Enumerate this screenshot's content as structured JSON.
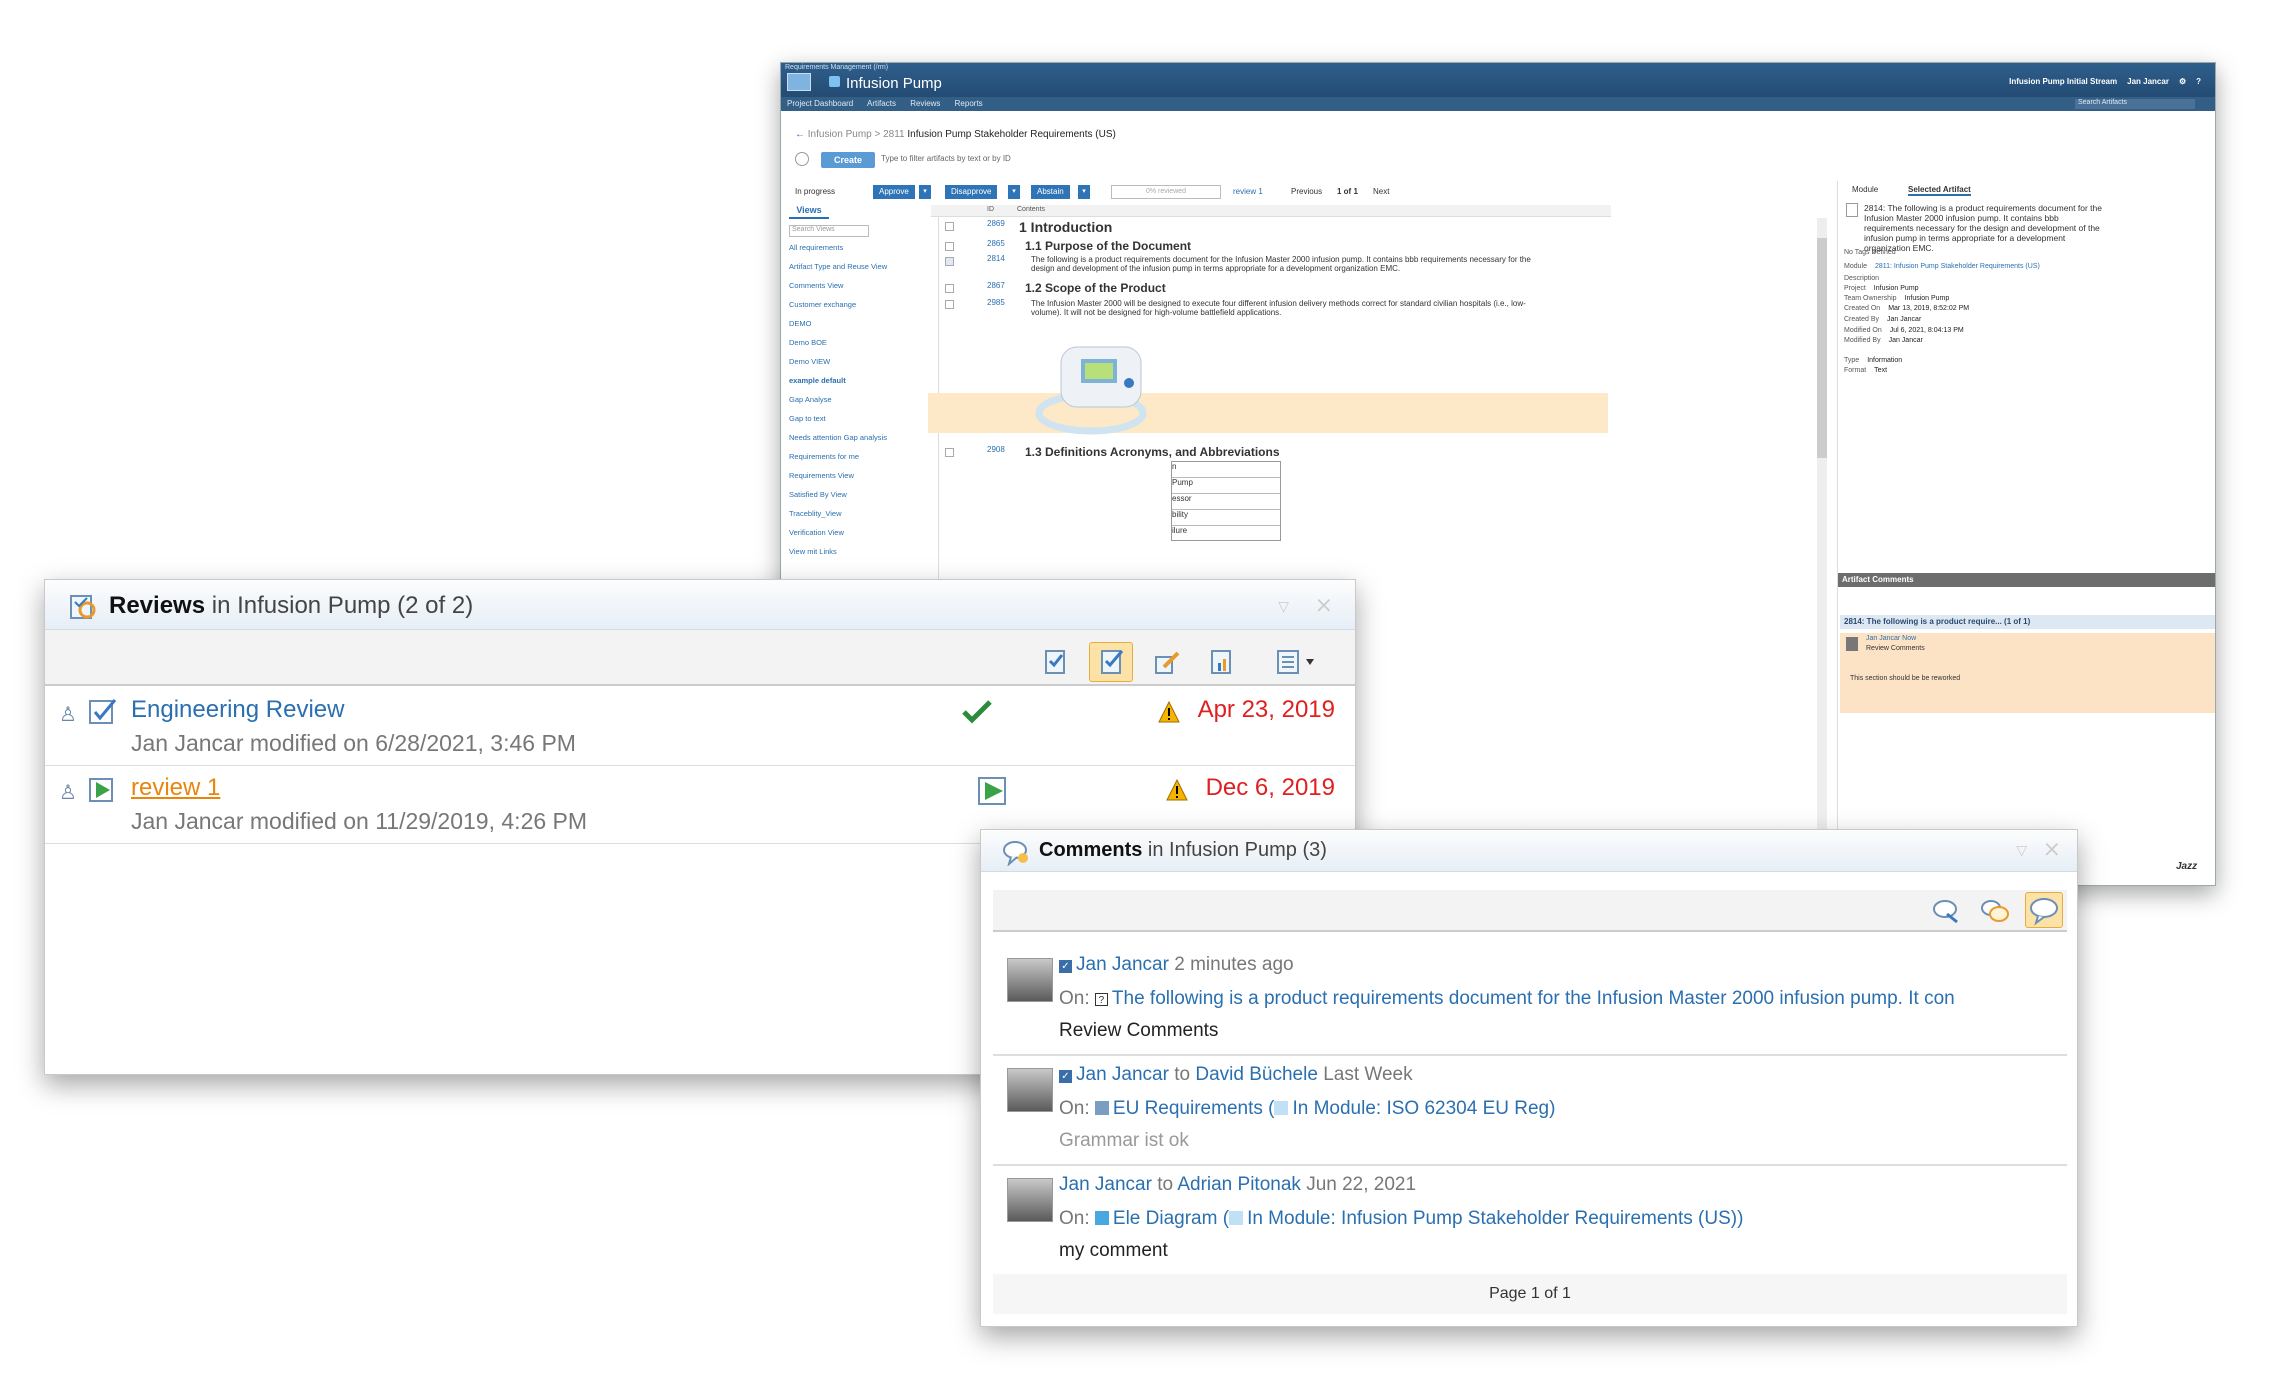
{
  "rm": {
    "app_small": "Requirements Management (/rm)",
    "project_title": "Infusion Pump",
    "stream": "Infusion Pump Initial Stream",
    "user": "Jan Jancar",
    "nav": [
      "Project Dashboard",
      "Artifacts",
      "Reviews",
      "Reports"
    ],
    "search_artifacts": "Search Artifacts",
    "breadcrumb_project": "Infusion Pump >",
    "breadcrumb_id": "2811",
    "breadcrumb_title": "Infusion Pump Stakeholder Requirements (US)",
    "create_label": "Create",
    "filter_placeholder": "Type to filter artifacts by text or by ID",
    "status": "In progress",
    "approve": "Approve",
    "disapprove": "Disapprove",
    "abstain": "Abstain",
    "progress": "0% reviewed",
    "review_link": "review 1",
    "previous": "Previous",
    "page": "1 of 1",
    "next": "Next",
    "views_tab": "Views",
    "search_views": "Search Views",
    "views": [
      "All requirements",
      "Artifact Type and Reuse View",
      "Comments View",
      "Customer exchange",
      "DEMO",
      "Demo BOE",
      "Demo VIEW",
      "example default",
      "Gap Analyse",
      "Gap to text",
      "Needs attention Gap analysis",
      "Requirements for me",
      "Requirements View",
      "Satisfied By View",
      "Traceblity_View",
      "Verification View",
      "View mit Links"
    ],
    "col_id": "ID",
    "col_contents": "Contents",
    "rows": [
      {
        "id": "2869",
        "heading": "1  Introduction"
      },
      {
        "id": "2865",
        "heading": "1.1  Purpose of the Document"
      },
      {
        "id": "2814",
        "text": "The following is a product requirements document for the Infusion Master 2000 infusion pump. It contains bbb requirements necessary for the design and development of the infusion pump in terms appropriate for a development organization EMC."
      },
      {
        "id": "2867",
        "heading": "1.2  Scope of the Product"
      },
      {
        "id": "2985",
        "text": "The Infusion Master 2000 will be designed to execute four different infusion delivery methods correct for standard civilian hospitals (i.e., low-volume). It will not be designed for high-volume battlefield applications."
      },
      {
        "id": "2908",
        "heading": "1.3  Definitions Acronyms, and Abbreviations"
      }
    ],
    "table_fragments": [
      "n",
      "Pump",
      "essor",
      "bility",
      "ilure"
    ],
    "side_tabs": [
      "Module",
      "Selected Artifact"
    ],
    "artifact_title": "2814: The following is a product requirements document for the Infusion Master 2000 infusion pump. It contains bbb requirements necessary for the design and development of the infusion pump in terms appropriate for a development organization EMC.",
    "no_tags": "No Tags Defined",
    "props": [
      {
        "k": "Module",
        "v": "2811: Infusion Pump Stakeholder Requirements (US)"
      },
      {
        "k": "Description",
        "v": ""
      },
      {
        "k": "Project",
        "v": "Infusion Pump"
      },
      {
        "k": "Team Ownership",
        "v": "Infusion Pump"
      },
      {
        "k": "Created On",
        "v": "Mar 13, 2019, 8:52:02 PM"
      },
      {
        "k": "Created By",
        "v": "Jan Jancar"
      },
      {
        "k": "Modified On",
        "v": "Jul 6, 2021, 8:04:13 PM"
      },
      {
        "k": "Modified By",
        "v": "Jan Jancar"
      },
      {
        "k": "Type",
        "v": "Information"
      },
      {
        "k": "Format",
        "v": "Text"
      }
    ],
    "artifact_comments": "Artifact Comments",
    "ac_row": "2814: The following is a product require... (1 of 1)",
    "ac_user": "Jan Jancar Now",
    "ac_subject": "Review Comments",
    "ac_text": "This section should be be reworked",
    "brand": "Jazz"
  },
  "reviews": {
    "title_bold": "Reviews",
    "title_rest": " in Infusion Pump (2 of 2)",
    "items": [
      {
        "name": "Engineering Review",
        "sub": "Jan Jancar modified on 6/28/2021, 3:46 PM",
        "date": "Apr 23, 2019"
      },
      {
        "name": "review 1",
        "sub": "Jan Jancar modified on 11/29/2019, 4:26 PM",
        "date": "Dec 6, 2019"
      }
    ]
  },
  "comments": {
    "title_bold": "Comments",
    "title_rest": " in Infusion Pump (3)",
    "on_label": "On:",
    "to_label": "to",
    "items": [
      {
        "author": "Jan Jancar",
        "to": "",
        "time": "2 minutes ago",
        "on": "The following is a product requirements document for the Infusion Master 2000 infusion pump. It con",
        "on_module": "",
        "body": "Review Comments"
      },
      {
        "author": "Jan Jancar",
        "to": "David Büchele",
        "time": "Last Week",
        "on": "EU Requirements (",
        "on_module": "In Module: ISO 62304 EU Reg)",
        "body": "Grammar ist ok"
      },
      {
        "author": "Jan Jancar",
        "to": "Adrian Pitonak",
        "time": "Jun 22, 2021",
        "on": "Ele Diagram (",
        "on_module": "In Module: Infusion Pump Stakeholder Requirements (US))",
        "body": "my comment"
      }
    ],
    "pager": "Page 1 of 1"
  }
}
